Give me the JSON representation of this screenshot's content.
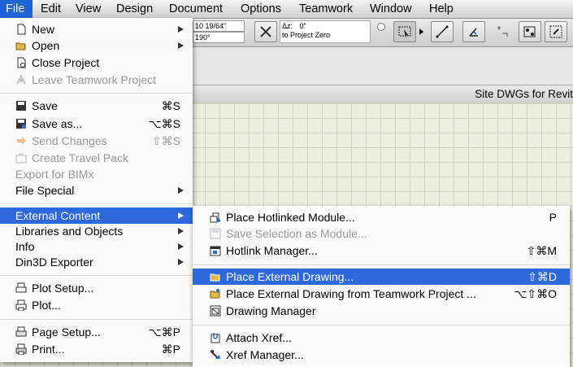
{
  "menubar": {
    "items": [
      "File",
      "Edit",
      "View",
      "Design",
      "Document",
      "Options",
      "Teamwork",
      "Window",
      "Help"
    ]
  },
  "toolbar": {
    "field1": "10 19/64\"",
    "field2": "190°",
    "dz_label": "Δz:",
    "dz_value": "0\"",
    "dz_ref": "to Project Zero"
  },
  "window_title": "Site DWGs for Revit",
  "file_menu": {
    "items": [
      {
        "label": "New",
        "icon": "new-document-icon",
        "shortcut": "",
        "submenu": true,
        "enabled": true
      },
      {
        "label": "Open",
        "icon": "open-folder-icon",
        "shortcut": "",
        "submenu": true,
        "enabled": true
      },
      {
        "label": "Close Project",
        "icon": "close-project-icon",
        "shortcut": "",
        "submenu": false,
        "enabled": true
      },
      {
        "label": "Leave Teamwork Project",
        "icon": "teamwork-icon",
        "shortcut": "",
        "submenu": false,
        "enabled": false
      },
      {
        "label": "Save",
        "icon": "save-icon",
        "shortcut": "⌘S",
        "submenu": false,
        "enabled": true
      },
      {
        "label": "Save as...",
        "icon": "save-as-icon",
        "shortcut": "⌥⌘S",
        "submenu": false,
        "enabled": true
      },
      {
        "label": "Send Changes",
        "icon": "send-changes-icon",
        "shortcut": "⇧⌘S",
        "submenu": false,
        "enabled": false
      },
      {
        "label": "Create Travel Pack",
        "icon": "travel-pack-icon",
        "shortcut": "",
        "submenu": false,
        "enabled": false
      },
      {
        "label": "Export for BIMx",
        "icon": "",
        "shortcut": "",
        "submenu": false,
        "enabled": false
      },
      {
        "label": "File Special",
        "icon": "",
        "shortcut": "",
        "submenu": true,
        "enabled": true
      },
      {
        "label": "External Content",
        "icon": "",
        "shortcut": "",
        "submenu": true,
        "enabled": true,
        "highlighted": true
      },
      {
        "label": "Libraries and Objects",
        "icon": "",
        "shortcut": "",
        "submenu": true,
        "enabled": true
      },
      {
        "label": "Info",
        "icon": "",
        "shortcut": "",
        "submenu": true,
        "enabled": true
      },
      {
        "label": "Din3D Exporter",
        "icon": "",
        "shortcut": "",
        "submenu": true,
        "enabled": true
      },
      {
        "label": "Plot Setup...",
        "icon": "plot-setup-icon",
        "shortcut": "",
        "submenu": false,
        "enabled": true
      },
      {
        "label": "Plot...",
        "icon": "plot-icon",
        "shortcut": "",
        "submenu": false,
        "enabled": true
      },
      {
        "label": "Page Setup...",
        "icon": "page-setup-icon",
        "shortcut": "⌥⌘P",
        "submenu": false,
        "enabled": true
      },
      {
        "label": "Print...",
        "icon": "print-icon",
        "shortcut": "⌘P",
        "submenu": false,
        "enabled": true
      }
    ]
  },
  "external_content_menu": {
    "items": [
      {
        "label": "Place Hotlinked Module...",
        "icon": "hotlinked-module-icon",
        "shortcut": "P",
        "enabled": true
      },
      {
        "label": "Save Selection as Module...",
        "icon": "save-module-icon",
        "shortcut": "",
        "enabled": false
      },
      {
        "label": "Hotlink Manager...",
        "icon": "hotlink-manager-icon",
        "shortcut": "⇧⌘M",
        "enabled": true
      },
      {
        "label": "Place External Drawing...",
        "icon": "external-drawing-icon",
        "shortcut": "⇧⌘D",
        "enabled": true,
        "highlighted": true
      },
      {
        "label": "Place External Drawing from Teamwork Project ...",
        "icon": "teamwork-drawing-icon",
        "shortcut": "⌥⇧⌘O",
        "enabled": true
      },
      {
        "label": "Drawing Manager",
        "icon": "drawing-manager-icon",
        "shortcut": "",
        "enabled": true
      },
      {
        "label": "Attach Xref...",
        "icon": "attach-xref-icon",
        "shortcut": "",
        "enabled": true
      },
      {
        "label": "Xref Manager...",
        "icon": "xref-manager-icon",
        "shortcut": "",
        "enabled": true
      }
    ]
  },
  "colors": {
    "highlight": "#2d69dc",
    "menubar_active": "#1f62d8",
    "disabled_text": "#9a9a9a"
  }
}
